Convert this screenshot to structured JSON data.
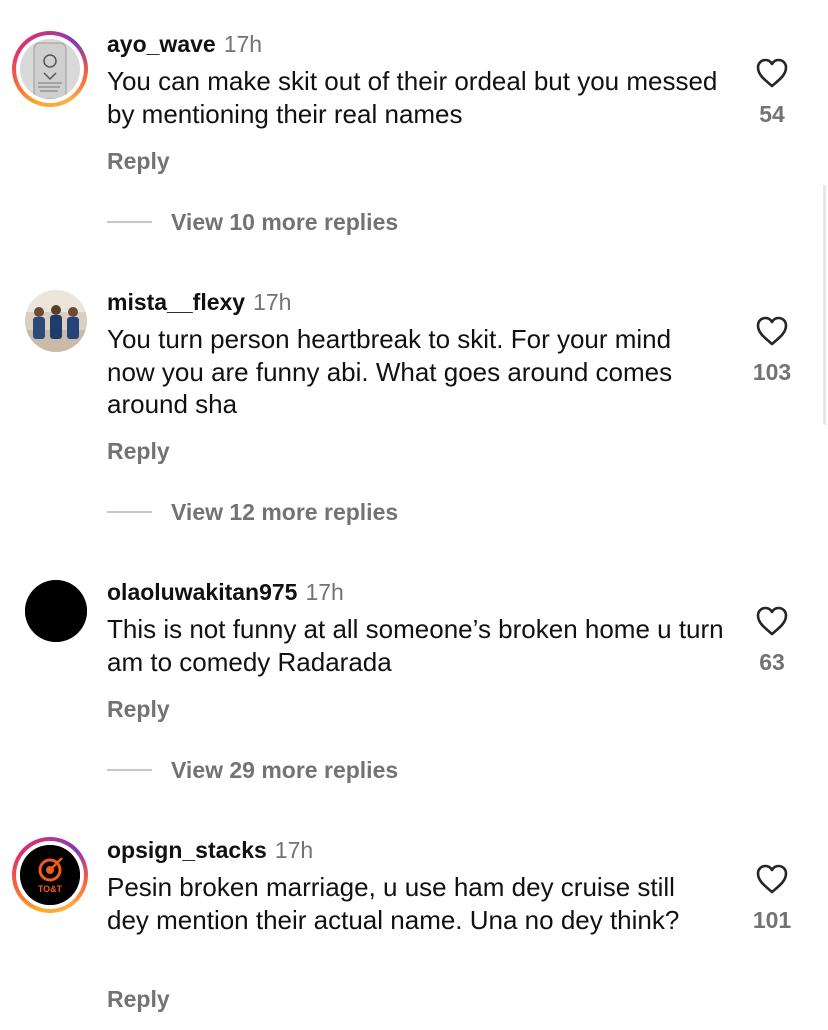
{
  "comments": [
    {
      "username": "ayo_wave",
      "time": "17h",
      "text": "You can make skit out of their ordeal but you messed by mentioning their real names",
      "likes": "54",
      "reply_label": "Reply",
      "view_replies": "View 10 more replies",
      "avatar_icon": "profile-photo"
    },
    {
      "username": "mista__flexy",
      "time": "17h",
      "text": "You turn person heartbreak to skit.  For your mind now you are funny abi.  What goes around comes around sha",
      "likes": "103",
      "reply_label": "Reply",
      "view_replies": "View 12 more replies",
      "avatar_icon": "profile-photo"
    },
    {
      "username": "olaoluwakitan975",
      "time": "17h",
      "text": "This is not funny at all someone’s broken home u turn am to comedy Radarada",
      "likes": "63",
      "reply_label": "Reply",
      "view_replies": "View 29 more replies",
      "avatar_icon": "profile-photo"
    },
    {
      "username": "opsign_stacks",
      "time": "17h",
      "text": "Pesin broken marriage, u use ham dey cruise still dey mention their actual name. Una no dey think?",
      "likes": "101",
      "reply_label": "Reply",
      "avatar_icon": "profile-photo",
      "avatar_logo_text": "TO&T"
    }
  ],
  "colors": {
    "text_primary": "#111111",
    "text_secondary": "#737373",
    "divider": "#c7c7c7",
    "story_ring": [
      "#f9a825",
      "#e1306c",
      "#833ab4"
    ]
  },
  "icons": {
    "like": "heart-outline-icon"
  }
}
